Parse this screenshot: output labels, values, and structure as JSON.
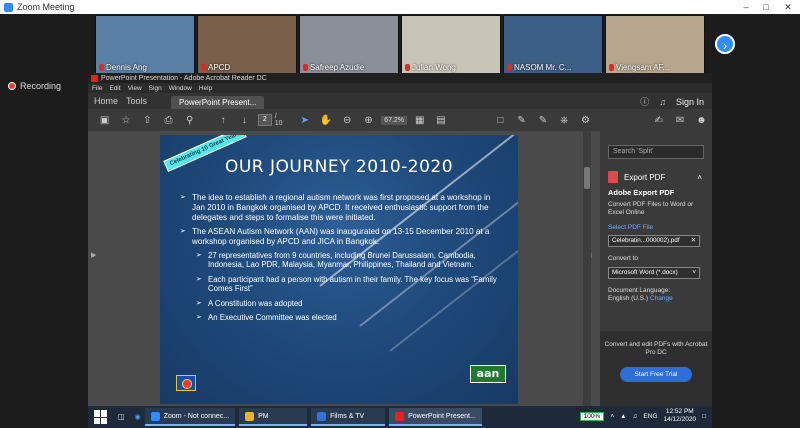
{
  "zoom": {
    "window_title": "Zoom Meeting",
    "recording_label": "Recording",
    "participants": [
      {
        "name": "Dennis Ang",
        "bg": "#5a7fa5"
      },
      {
        "name": "APCD",
        "bg": "#7a5f4a"
      },
      {
        "name": "Safreep Azudie",
        "bg": "#8a8f99"
      },
      {
        "name": "Julian Wong",
        "bg": "#c9c4b8"
      },
      {
        "name": "NASOM Mr. C...",
        "bg": "#3c5f88"
      },
      {
        "name": "Viengsam AF...",
        "bg": "#b8a58e"
      }
    ],
    "next_icon": "chevron-right-icon"
  },
  "acrobat": {
    "window_title": "PowerPoint Presentation - Adobe Acrobat Reader DC",
    "menu": [
      "File",
      "Edit",
      "View",
      "Sign",
      "Window",
      "Help"
    ],
    "tabs": {
      "home": "Home",
      "tools": "Tools",
      "doc": "PowerPoint Present...",
      "sign_in": "Sign In"
    },
    "page_current": "2",
    "page_total": "/ 10",
    "zoom": "67.2%",
    "search_placeholder": "Search 'Split'",
    "export_title": "Export PDF",
    "card": {
      "heading": "Adobe Export PDF",
      "desc": "Convert PDF Files to Word or Excel Online",
      "select_label": "Select PDF File",
      "file": "Celebratin...000002).pdf",
      "convert_label": "Convert to",
      "convert_value": "Microsoft Word (*.docx)",
      "lang_label": "Document Language:",
      "lang_value": "English (U.S.)",
      "change": "Change"
    },
    "cta": {
      "text": "Convert and edit PDFs with Acrobat Pro DC",
      "button": "Start Free Trial"
    }
  },
  "slide": {
    "banner": "Celebrating 10 Great Years",
    "title": "OUR JOURNEY 2010-2020",
    "bullets": [
      "The idea to establish a regional autism network was first proposed at a workshop in Jan 2010 in Bangkok organised by APCD. It received enthusiastic support from the delegates and steps to formalise this were initiated.",
      "The ASEAN Autism Network (AAN) was inaugurated on 13-15 December 2010 at a workshop organised by APCD and JICA in Bangkok."
    ],
    "sub_bullets": [
      "27 representatives from 9 countries, including Brunei Darussalam, Cambodia, Indonesia, Lao PDR, Malaysia, Myanmar, Philippines, Thailand and Vietnam.",
      "Each participant had a person with autism in their family. The key focus was “Family Comes First”",
      "A Constitution was adopted",
      "An Executive Committee was elected"
    ],
    "logo_text": "aan"
  },
  "taskbar": {
    "apps": [
      {
        "label": "Zoom - Not connec...",
        "color": "#2d8cff"
      },
      {
        "label": "PM",
        "color": "#e8b23a"
      },
      {
        "label": "Films & TV",
        "color": "#2f74d6"
      },
      {
        "label": "PowerPoint Present...",
        "color": "#e52222"
      }
    ],
    "battery": "100%",
    "lang": "ENG",
    "time": "12:52 PM",
    "date": "14/12/2020"
  }
}
